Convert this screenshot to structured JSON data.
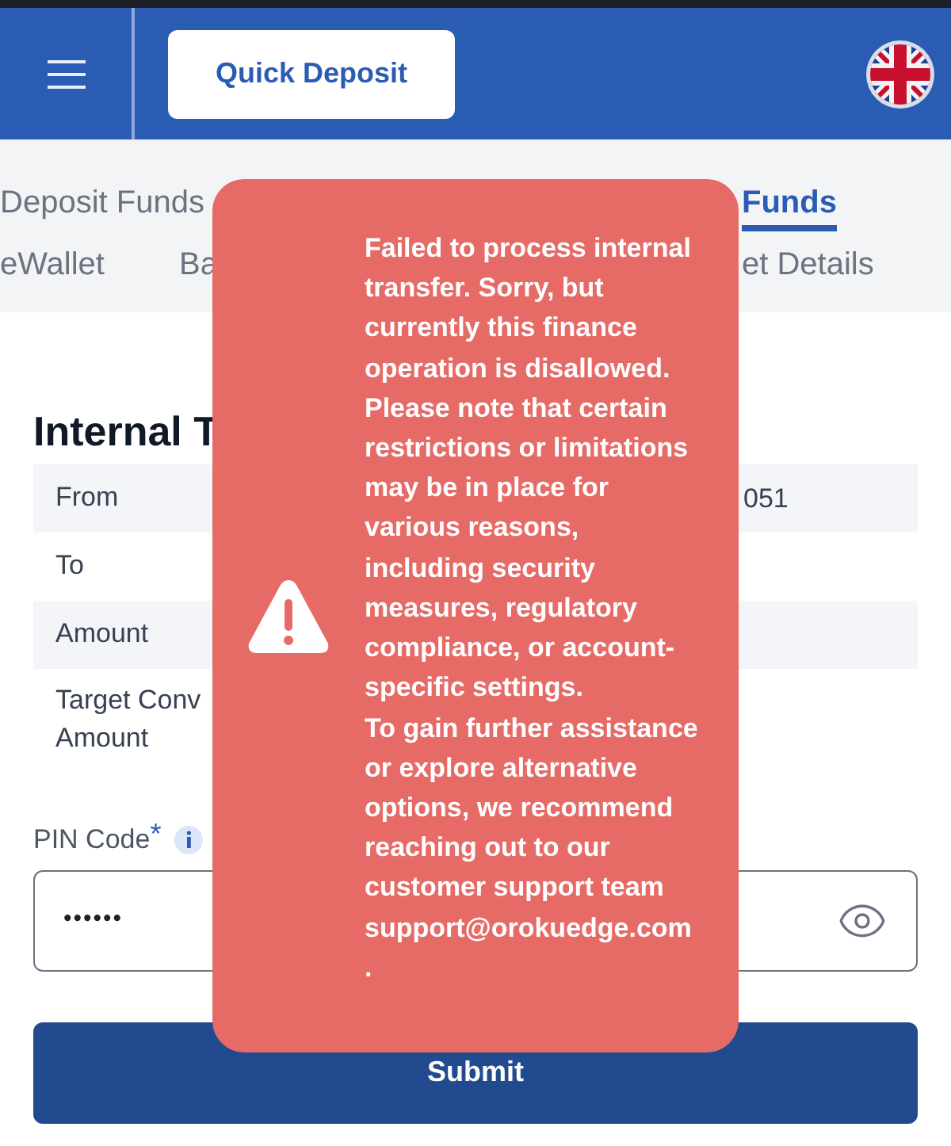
{
  "header": {
    "quick_deposit_button": "Quick Deposit"
  },
  "tabs": [
    {
      "label": "Deposit Funds",
      "selected": false
    },
    {
      "label": "Funds",
      "selected": true
    }
  ],
  "subtabs": [
    {
      "label": "eWallet"
    },
    {
      "label": "Ba"
    },
    {
      "label": "et Details"
    }
  ],
  "section_title": "Internal T",
  "details": [
    {
      "label": "From",
      "value": "051"
    },
    {
      "label": "To"
    },
    {
      "label": "Amount"
    },
    {
      "label": "Target Conv\nAmount"
    }
  ],
  "pin": {
    "label": "PIN Code",
    "required_mark": "*",
    "value": "••••••"
  },
  "submit_button": "Submit",
  "toast": {
    "paragraphs": [
      "Failed to process internal transfer. Sorry, but currently this finance operation is disallowed. Please note that certain restrictions or limitations may be in place for various reasons, including security measures, regulatory compliance, or account-specific settings.",
      "To gain further assistance or explore alternative options, we recommend reaching out to our customer support team support@orokuedge.com",
      "."
    ]
  }
}
